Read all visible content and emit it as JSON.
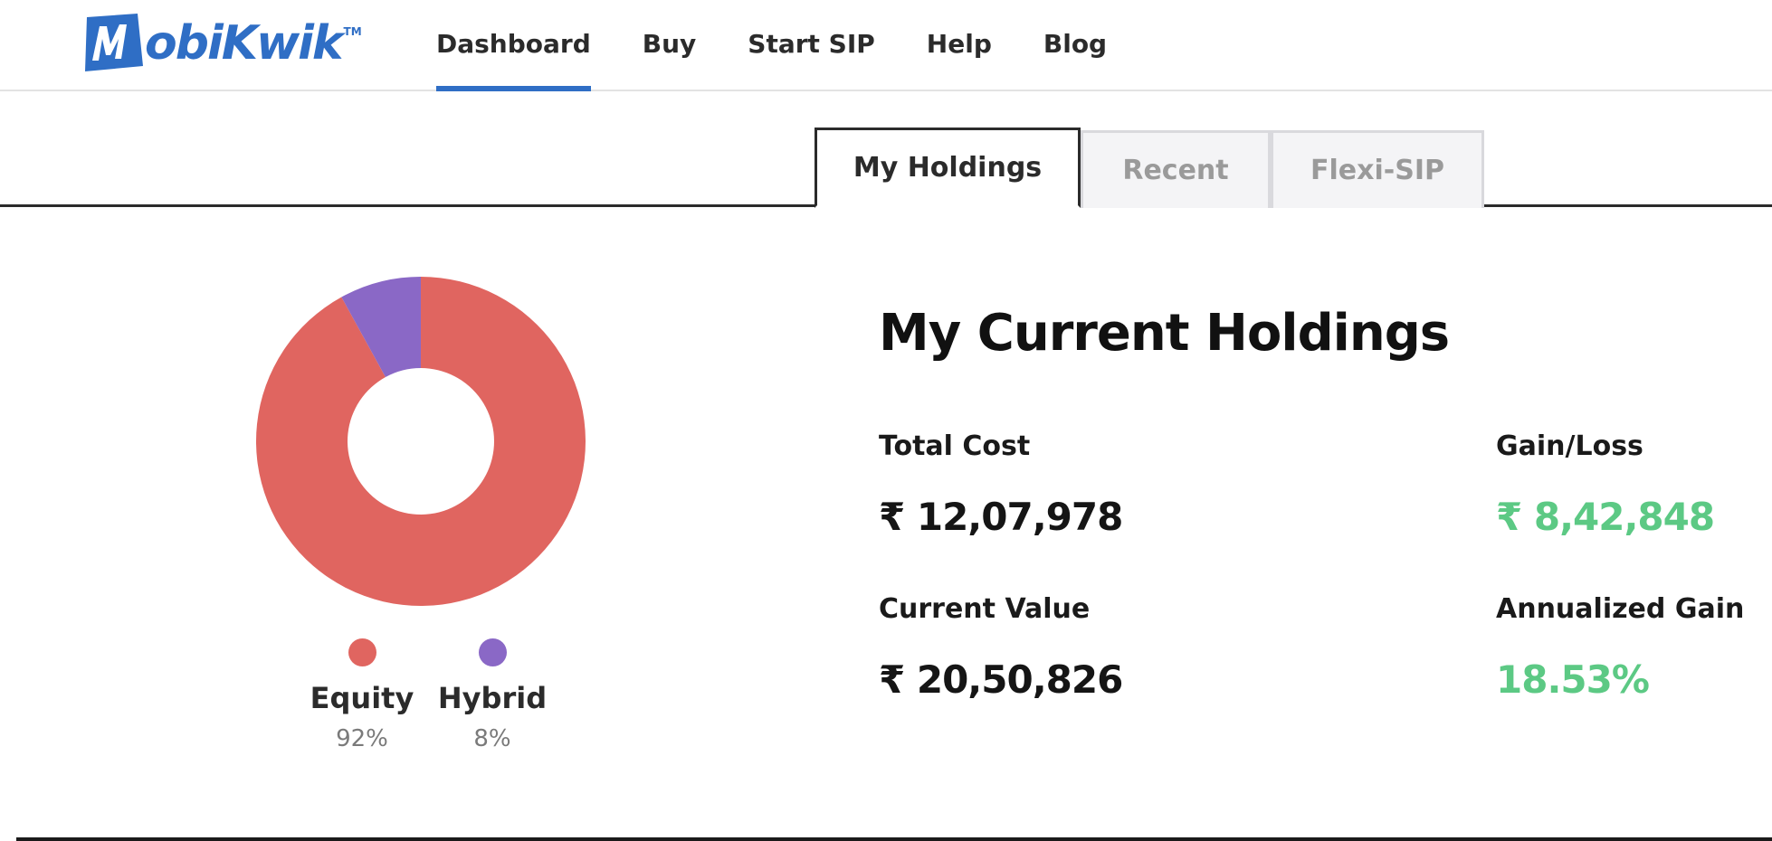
{
  "brand": {
    "logo_mark": "M",
    "logo_text": "obiKwik",
    "logo_tm": "TM",
    "color": "#2f6ec5"
  },
  "nav": {
    "items": [
      {
        "label": "Dashboard",
        "active": true
      },
      {
        "label": "Buy",
        "active": false
      },
      {
        "label": "Start SIP",
        "active": false
      },
      {
        "label": "Help",
        "active": false
      },
      {
        "label": "Blog",
        "active": false
      }
    ]
  },
  "tabs": [
    {
      "label": "My Holdings",
      "active": true
    },
    {
      "label": "Recent",
      "active": false
    },
    {
      "label": "Flexi-SIP",
      "active": false
    }
  ],
  "chart_data": {
    "type": "pie",
    "donut": true,
    "categories": [
      "Equity",
      "Hybrid"
    ],
    "values": [
      92,
      8
    ],
    "labels": [
      "92%",
      "8%"
    ],
    "colors": [
      "#e06560",
      "#8a68c6"
    ]
  },
  "holdings": {
    "title": "My Current Holdings",
    "total_cost_label": "Total Cost",
    "total_cost_value": "₹ 12,07,978",
    "gain_loss_label": "Gain/Loss",
    "gain_loss_value": "₹ 8,42,848",
    "current_value_label": "Current Value",
    "current_value_value": "₹ 20,50,826",
    "annualized_gain_label": "Annualized Gain",
    "annualized_gain_value": "18.53%",
    "positive_color": "#5cc984"
  }
}
